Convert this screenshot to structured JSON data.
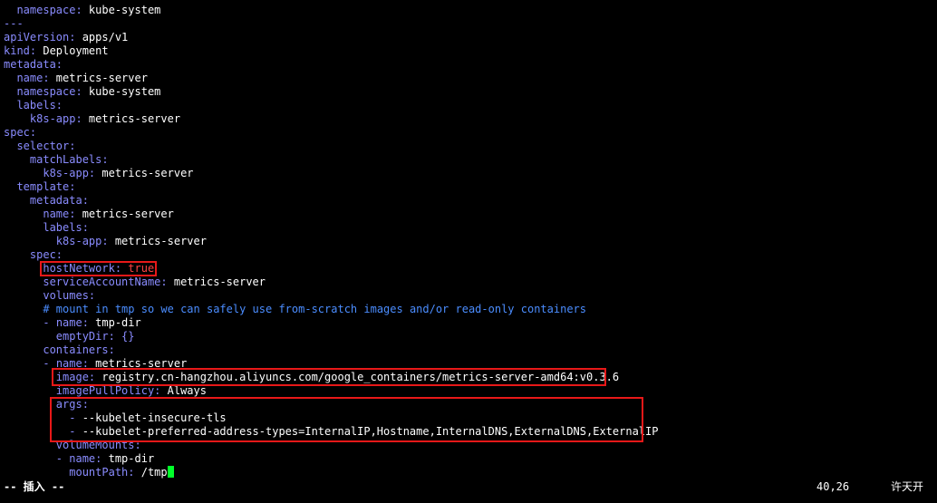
{
  "editor": {
    "lines": [
      {
        "segments": [
          {
            "text": "  ",
            "cls": ""
          },
          {
            "text": "namespace:",
            "cls": "k"
          },
          {
            "text": " kube-system",
            "cls": ""
          }
        ]
      },
      {
        "segments": [
          {
            "text": "---",
            "cls": "dash"
          }
        ]
      },
      {
        "segments": [
          {
            "text": "apiVersion:",
            "cls": "k"
          },
          {
            "text": " apps/v1",
            "cls": ""
          }
        ]
      },
      {
        "segments": [
          {
            "text": "kind:",
            "cls": "k"
          },
          {
            "text": " Deployment",
            "cls": ""
          }
        ]
      },
      {
        "segments": [
          {
            "text": "metadata:",
            "cls": "k"
          }
        ]
      },
      {
        "segments": [
          {
            "text": "  ",
            "cls": ""
          },
          {
            "text": "name:",
            "cls": "k"
          },
          {
            "text": " metrics-server",
            "cls": ""
          }
        ]
      },
      {
        "segments": [
          {
            "text": "  ",
            "cls": ""
          },
          {
            "text": "namespace:",
            "cls": "k"
          },
          {
            "text": " kube-system",
            "cls": ""
          }
        ]
      },
      {
        "segments": [
          {
            "text": "  ",
            "cls": ""
          },
          {
            "text": "labels:",
            "cls": "k"
          }
        ]
      },
      {
        "segments": [
          {
            "text": "    ",
            "cls": ""
          },
          {
            "text": "k8s-app:",
            "cls": "k"
          },
          {
            "text": " metrics-server",
            "cls": ""
          }
        ]
      },
      {
        "segments": [
          {
            "text": "spec:",
            "cls": "k"
          }
        ]
      },
      {
        "segments": [
          {
            "text": "  ",
            "cls": ""
          },
          {
            "text": "selector:",
            "cls": "k"
          }
        ]
      },
      {
        "segments": [
          {
            "text": "    ",
            "cls": ""
          },
          {
            "text": "matchLabels:",
            "cls": "k"
          }
        ]
      },
      {
        "segments": [
          {
            "text": "      ",
            "cls": ""
          },
          {
            "text": "k8s-app:",
            "cls": "k"
          },
          {
            "text": " metrics-server",
            "cls": ""
          }
        ]
      },
      {
        "segments": [
          {
            "text": "  ",
            "cls": ""
          },
          {
            "text": "template:",
            "cls": "k"
          }
        ]
      },
      {
        "segments": [
          {
            "text": "    ",
            "cls": ""
          },
          {
            "text": "metadata:",
            "cls": "k"
          }
        ]
      },
      {
        "segments": [
          {
            "text": "      ",
            "cls": ""
          },
          {
            "text": "name:",
            "cls": "k"
          },
          {
            "text": " metrics-server",
            "cls": ""
          }
        ]
      },
      {
        "segments": [
          {
            "text": "      ",
            "cls": ""
          },
          {
            "text": "labels:",
            "cls": "k"
          }
        ]
      },
      {
        "segments": [
          {
            "text": "        ",
            "cls": ""
          },
          {
            "text": "k8s-app:",
            "cls": "k"
          },
          {
            "text": " metrics-server",
            "cls": ""
          }
        ]
      },
      {
        "segments": [
          {
            "text": "    ",
            "cls": ""
          },
          {
            "text": "spec:",
            "cls": "k"
          }
        ]
      },
      {
        "segments": [
          {
            "text": "      ",
            "cls": ""
          },
          {
            "text": "hostNetwork:",
            "cls": "k"
          },
          {
            "text": " ",
            "cls": ""
          },
          {
            "text": "true",
            "cls": "red"
          }
        ]
      },
      {
        "segments": [
          {
            "text": "      ",
            "cls": ""
          },
          {
            "text": "serviceAccountName:",
            "cls": "k"
          },
          {
            "text": " metrics-server",
            "cls": ""
          }
        ]
      },
      {
        "segments": [
          {
            "text": "      ",
            "cls": ""
          },
          {
            "text": "volumes:",
            "cls": "k"
          }
        ]
      },
      {
        "segments": [
          {
            "text": "      ",
            "cls": ""
          },
          {
            "text": "# mount in tmp so we can safely use from-scratch images and/or read-only containers",
            "cls": "cm"
          }
        ]
      },
      {
        "segments": [
          {
            "text": "      ",
            "cls": ""
          },
          {
            "text": "- ",
            "cls": "k"
          },
          {
            "text": "name:",
            "cls": "k"
          },
          {
            "text": " tmp-dir",
            "cls": ""
          }
        ]
      },
      {
        "segments": [
          {
            "text": "        ",
            "cls": ""
          },
          {
            "text": "emptyDir:",
            "cls": "k"
          },
          {
            "text": " {}",
            "cls": "k"
          }
        ]
      },
      {
        "segments": [
          {
            "text": "      ",
            "cls": ""
          },
          {
            "text": "containers:",
            "cls": "k"
          }
        ]
      },
      {
        "segments": [
          {
            "text": "      ",
            "cls": ""
          },
          {
            "text": "- ",
            "cls": "k"
          },
          {
            "text": "name:",
            "cls": "k"
          },
          {
            "text": " metrics-server",
            "cls": ""
          }
        ]
      },
      {
        "segments": [
          {
            "text": "        ",
            "cls": ""
          },
          {
            "text": "image:",
            "cls": "k"
          },
          {
            "text": " registry.cn-hangzhou.aliyuncs.com/google_containers/metrics-server-amd64:v0.3.6",
            "cls": ""
          }
        ]
      },
      {
        "segments": [
          {
            "text": "        ",
            "cls": ""
          },
          {
            "text": "imagePullPolicy:",
            "cls": "k"
          },
          {
            "text": " Always",
            "cls": ""
          }
        ]
      },
      {
        "segments": [
          {
            "text": "        ",
            "cls": ""
          },
          {
            "text": "args:",
            "cls": "k"
          }
        ]
      },
      {
        "segments": [
          {
            "text": "          ",
            "cls": ""
          },
          {
            "text": "- ",
            "cls": "k"
          },
          {
            "text": "--kubelet-insecure-tls",
            "cls": ""
          }
        ]
      },
      {
        "segments": [
          {
            "text": "          ",
            "cls": ""
          },
          {
            "text": "- ",
            "cls": "k"
          },
          {
            "text": "--kubelet-preferred-address-types=InternalIP,Hostname,InternalDNS,ExternalDNS,ExternalIP",
            "cls": ""
          }
        ]
      },
      {
        "segments": [
          {
            "text": "        ",
            "cls": ""
          },
          {
            "text": "volumeMounts:",
            "cls": "k"
          }
        ]
      },
      {
        "segments": [
          {
            "text": "        ",
            "cls": ""
          },
          {
            "text": "- ",
            "cls": "k"
          },
          {
            "text": "name:",
            "cls": "k"
          },
          {
            "text": " tmp-dir",
            "cls": ""
          }
        ]
      },
      {
        "segments": [
          {
            "text": "          ",
            "cls": ""
          },
          {
            "text": "mountPath:",
            "cls": "k"
          },
          {
            "text": " /tmp",
            "cls": ""
          }
        ],
        "cursor": true
      }
    ]
  },
  "status": {
    "mode": "-- 插入 --",
    "position": "40,26",
    "scroll": "许天开"
  },
  "colors": {
    "key": "#8a8cff",
    "comment": "#4b8dff",
    "boolean": "#ff4444",
    "highlight_box": "#e81818",
    "cursor": "#00ff2a",
    "background": "#000000"
  }
}
